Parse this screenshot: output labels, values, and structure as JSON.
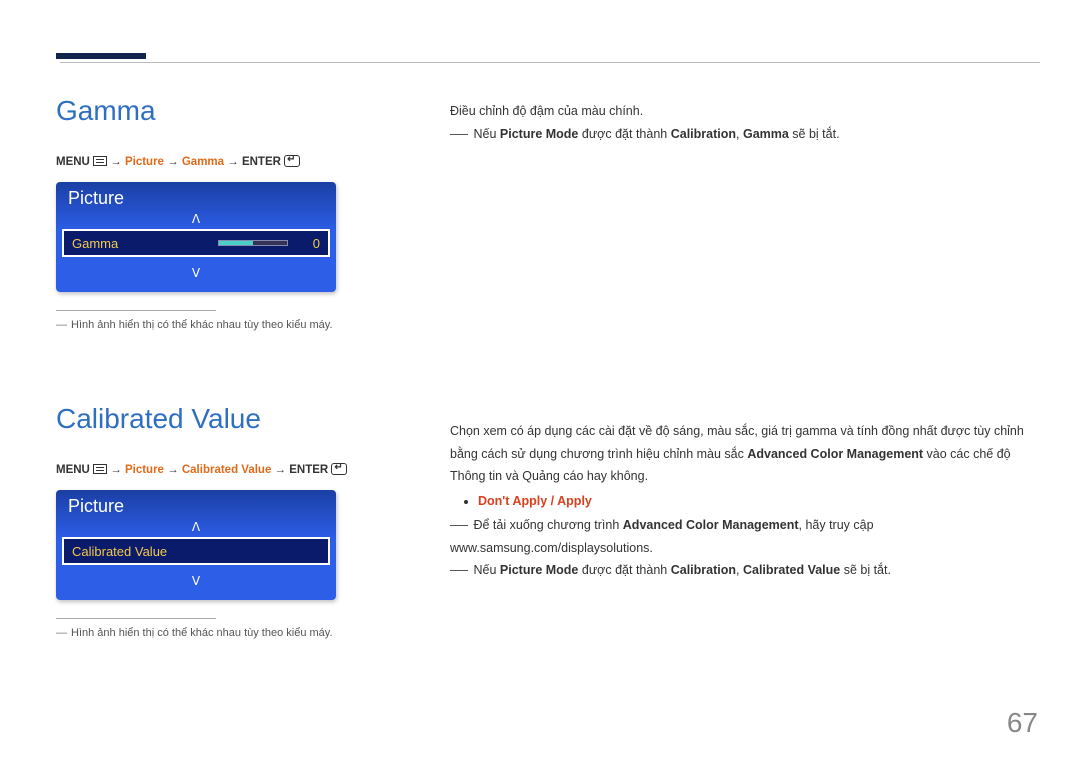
{
  "page_number": "67",
  "gamma": {
    "title": "Gamma",
    "breadcrumb": {
      "menu": "MENU",
      "p1": "Picture",
      "p2": "Gamma",
      "enter": "ENTER"
    },
    "osd": {
      "header": "Picture",
      "item_label": "Gamma",
      "item_value": "0",
      "arrow_up": "ᐱ",
      "arrow_down": "ᐯ"
    },
    "footnote": "Hình ảnh hiển thị có thể khác nhau tùy theo kiểu máy.",
    "desc1": "Điều chỉnh độ đậm của màu chính.",
    "note_prefix": "Nếu ",
    "note_pm": "Picture Mode",
    "note_mid": " được đặt thành ",
    "note_cal": "Calibration",
    "note_sep": ", ",
    "note_g": "Gamma",
    "note_suffix": " sẽ bị tắt."
  },
  "calibrated": {
    "title": "Calibrated Value",
    "breadcrumb": {
      "menu": "MENU",
      "p1": "Picture",
      "p2": "Calibrated Value",
      "enter": "ENTER"
    },
    "osd": {
      "header": "Picture",
      "item_label": "Calibrated Value",
      "arrow_up": "ᐱ",
      "arrow_down": "ᐯ"
    },
    "footnote": "Hình ảnh hiển thị có thể khác nhau tùy theo kiểu máy.",
    "desc_a": "Chọn xem có áp dụng các cài đặt về độ sáng, màu sắc, giá trị gamma và tính đồng nhất được tùy chỉnh bằng cách sử dụng chương trình hiệu chỉnh màu sắc ",
    "desc_b": "Advanced Color Management",
    "desc_c": " vào các chế độ Thông tin và Quảng cáo hay không.",
    "opts_dont": "Don't Apply",
    "opts_sep": " / ",
    "opts_apply": "Apply",
    "note1_a": "Để tải xuống chương trình ",
    "note1_b": "Advanced Color Management",
    "note1_c": ", hãy truy cập www.samsung.com/displaysolutions.",
    "note2_a": "Nếu ",
    "note2_pm": "Picture Mode",
    "note2_b": " được đặt thành ",
    "note2_cal": "Calibration",
    "note2_sep": ", ",
    "note2_cv": "Calibrated Value",
    "note2_c": " sẽ bị tắt."
  }
}
